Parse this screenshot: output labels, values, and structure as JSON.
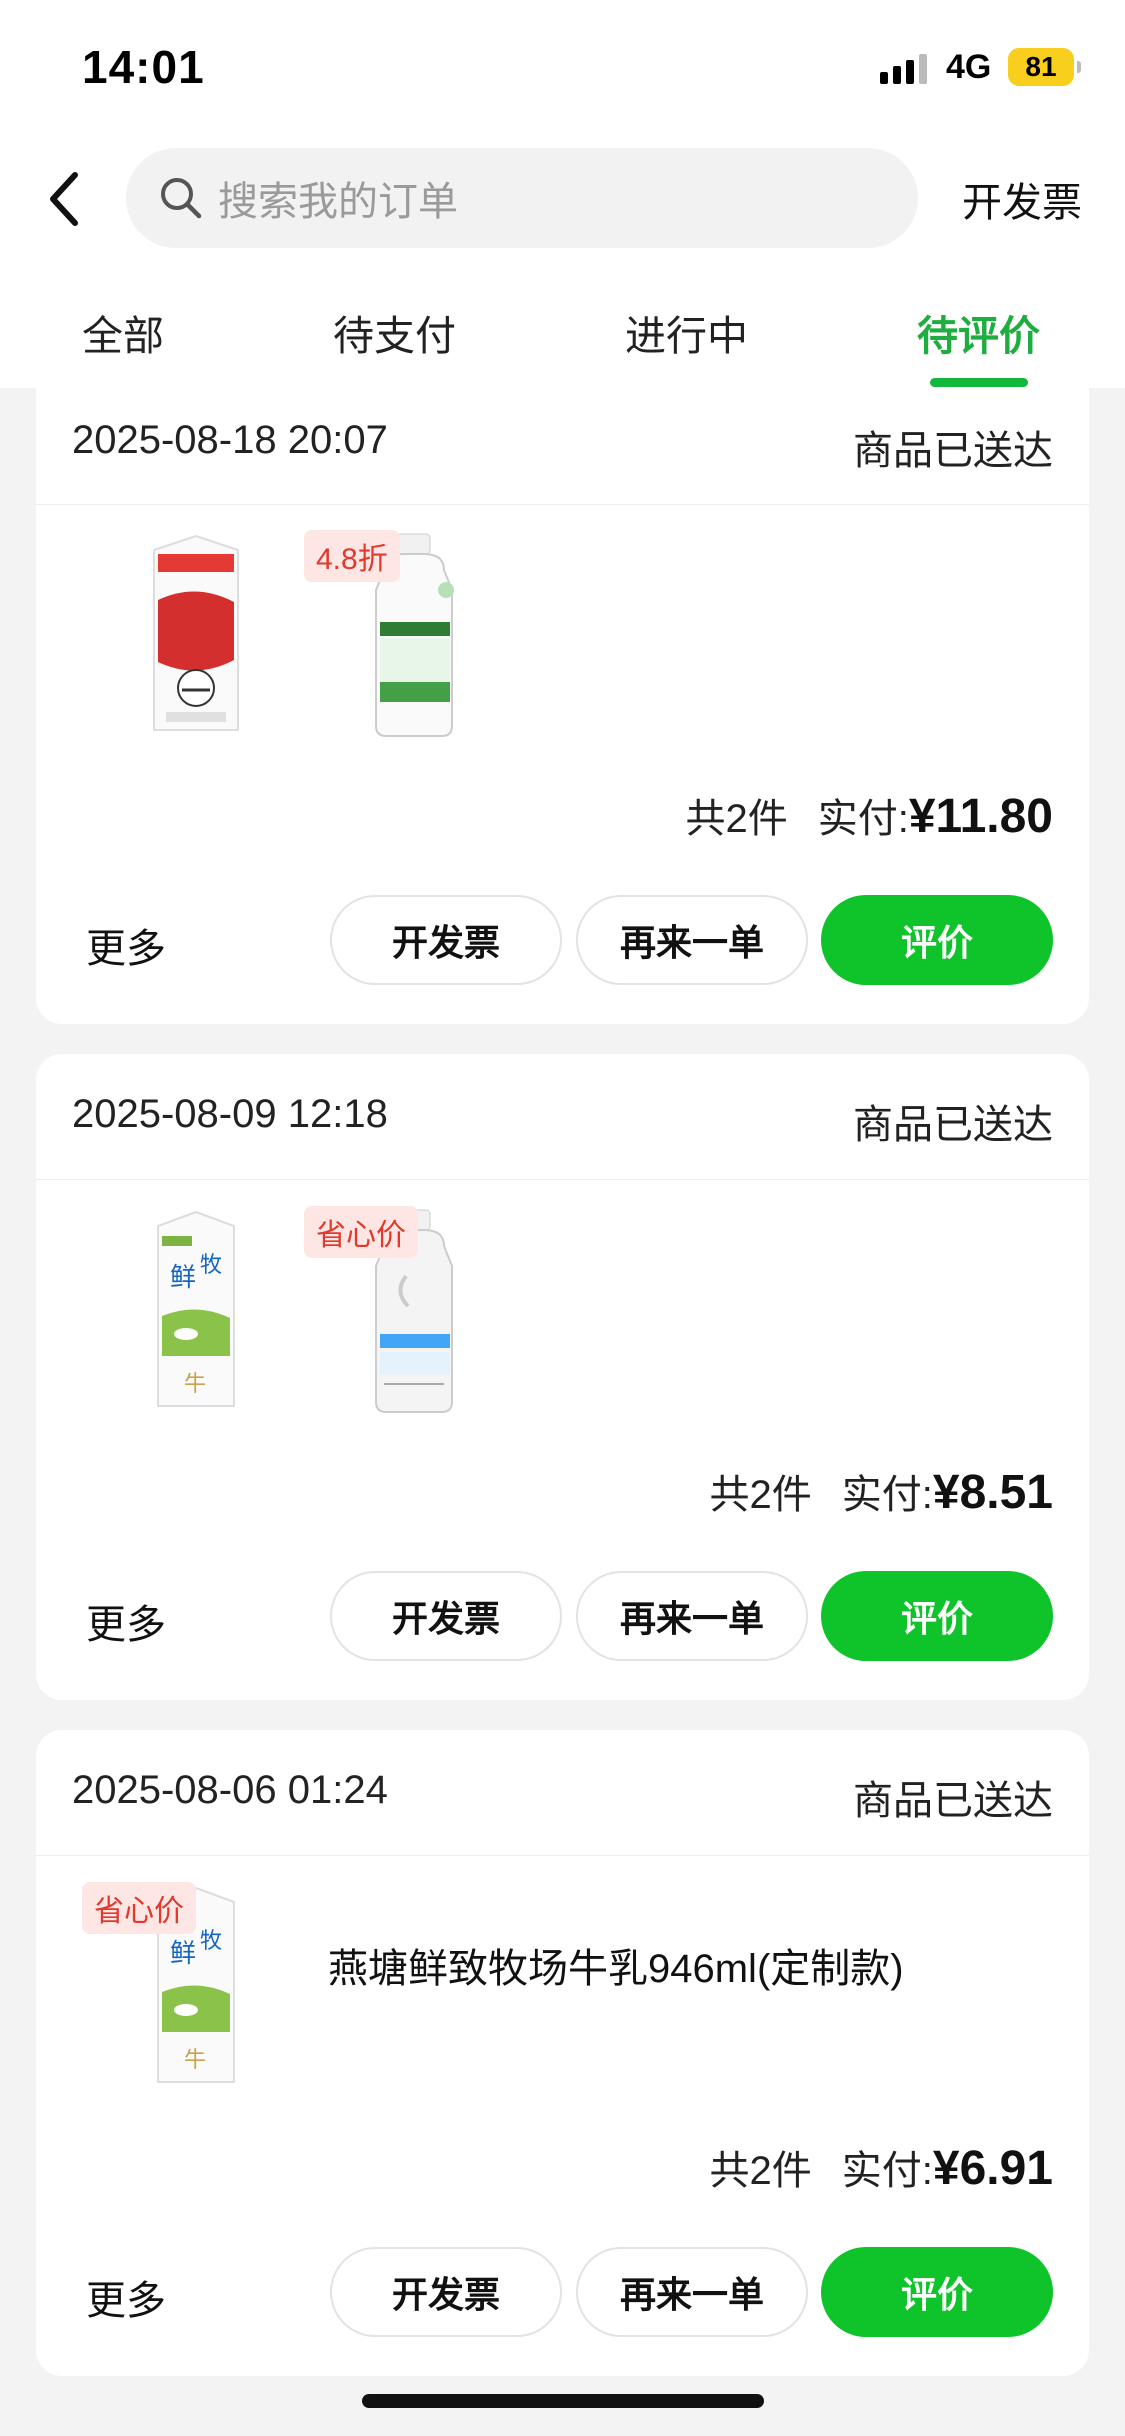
{
  "status_bar": {
    "time": "14:01",
    "network": "4G",
    "battery": "81"
  },
  "nav": {
    "search_placeholder": "搜索我的订单",
    "invoice_label": "开发票"
  },
  "tabs": [
    {
      "label": "全部"
    },
    {
      "label": "待支付"
    },
    {
      "label": "进行中"
    },
    {
      "label": "待评价"
    }
  ],
  "active_tab": "待评价",
  "orders": [
    {
      "datetime": "2025-08-18 20:07",
      "status": "商品已送达",
      "items": [
        {
          "image": "red-carton-milk",
          "tag": ""
        },
        {
          "image": "green-label-yogurt-bottle",
          "tag": "4.8折"
        }
      ],
      "count": "共2件",
      "paid_label": "实付:",
      "amount": "¥11.80",
      "more_label": "更多",
      "buttons": {
        "invoice": "开发票",
        "reorder": "再来一单",
        "review": "评价"
      }
    },
    {
      "datetime": "2025-08-09 12:18",
      "status": "商品已送达",
      "items": [
        {
          "image": "green-carton-milk",
          "tag": ""
        },
        {
          "image": "white-yogurt-bottle",
          "tag": "省心价"
        }
      ],
      "count": "共2件",
      "paid_label": "实付:",
      "amount": "¥8.51",
      "more_label": "更多",
      "buttons": {
        "invoice": "开发票",
        "reorder": "再来一单",
        "review": "评价"
      }
    },
    {
      "datetime": "2025-08-06 01:24",
      "status": "商品已送达",
      "items": [
        {
          "image": "green-carton-milk",
          "tag": "省心价"
        }
      ],
      "product_name": "燕塘鲜致牧场牛乳946ml(定制款)",
      "count": "共2件",
      "paid_label": "实付:",
      "amount": "¥6.91",
      "more_label": "更多",
      "buttons": {
        "invoice": "开发票",
        "reorder": "再来一单",
        "review": "评价"
      }
    }
  ],
  "colors": {
    "accent": "#0fc32b",
    "tab_active": "#1fad3f",
    "tag_text": "#e3382c",
    "tag_bg": "#fde6e4"
  }
}
